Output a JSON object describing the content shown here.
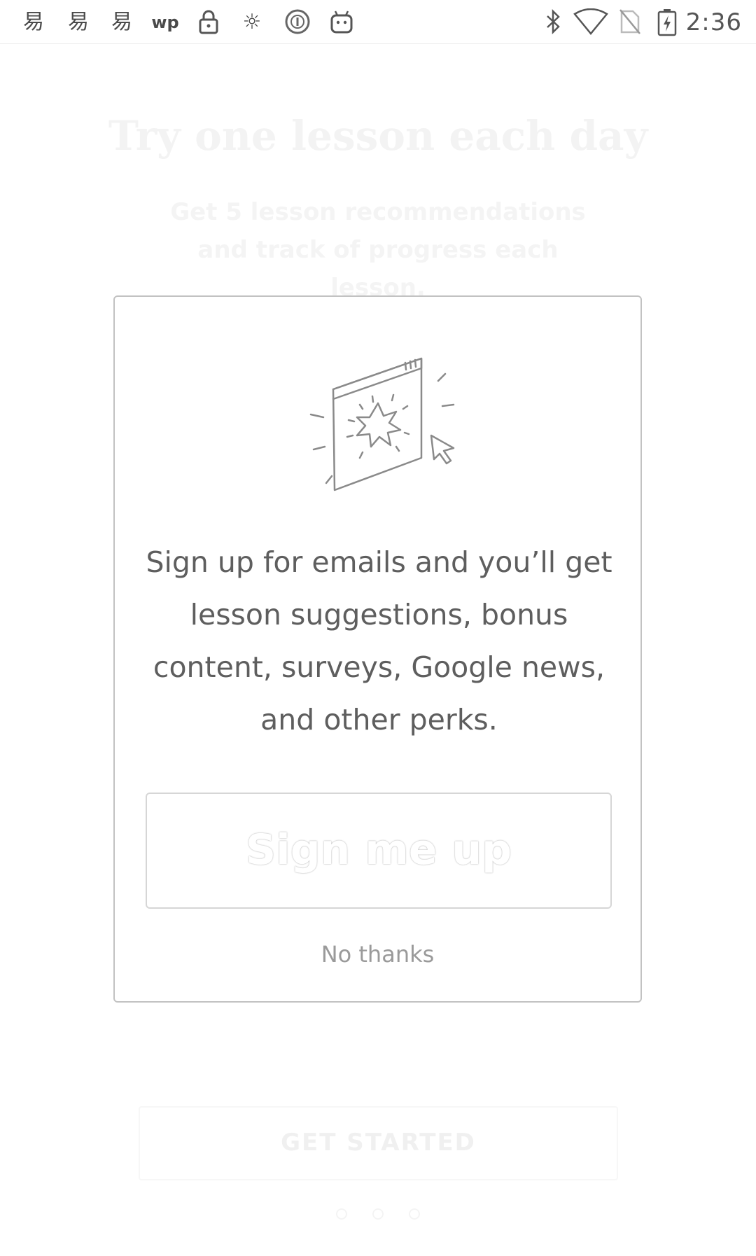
{
  "status_bar": {
    "time": "2:36",
    "left_icons": [
      "app-notification-icon",
      "app-notification-icon",
      "app-notification-icon",
      "wp-app-icon",
      "lock-icon",
      "app-notification-icon",
      "circle-notification-icon",
      "android-icon"
    ],
    "right_icons": [
      "bluetooth-icon",
      "wifi-icon",
      "no-sim-icon",
      "battery-charging-icon"
    ]
  },
  "background": {
    "title": "Try one lesson each day",
    "subtitle": "Get 5 lesson recommendations and track of progress each lesson.",
    "button_label": "GET STARTED"
  },
  "dialog": {
    "message": "Sign up for emails and you’ll get lesson suggestions, bonus content, surveys, Google news, and other perks.",
    "signup_label": "Sign me up",
    "dismiss_label": "No thanks"
  }
}
